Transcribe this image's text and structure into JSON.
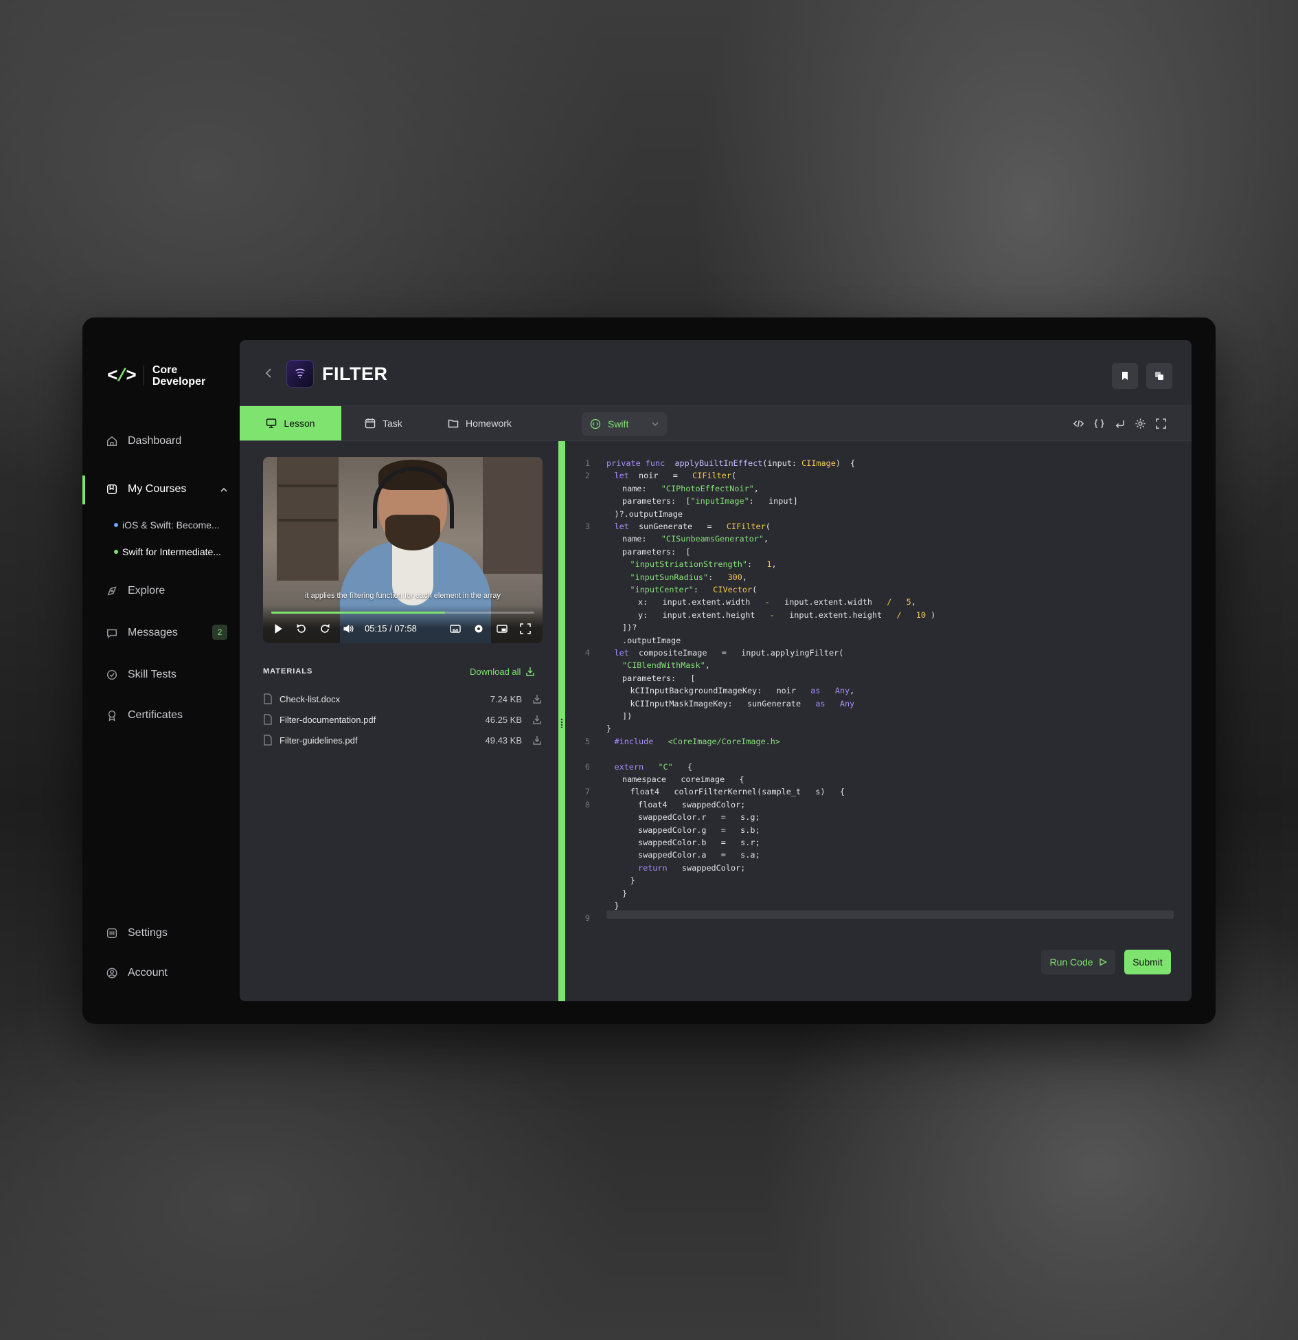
{
  "brand": {
    "line1": "Core",
    "line2": "Developer"
  },
  "nav": {
    "dashboard": "Dashboard",
    "my_courses": "My Courses",
    "courses": [
      {
        "label": "iOS & Swift: Become...",
        "dot_color": "#6aa8ff"
      },
      {
        "label": "Swift for Intermediate...",
        "dot_color": "#7ee36f"
      }
    ],
    "explore": "Explore",
    "messages": "Messages",
    "messages_count": "2",
    "skill_tests": "Skill Tests",
    "certificates": "Certificates",
    "settings": "Settings",
    "account": "Account"
  },
  "header": {
    "title": "FILTER"
  },
  "tabs": {
    "lesson": "Lesson",
    "task": "Task",
    "homework": "Homework",
    "language": "Swift"
  },
  "video": {
    "subtitle": "it applies the filtering function for each element in the array",
    "time": "05:15 / 07:58",
    "progress": 0.66
  },
  "materials": {
    "heading": "MATERIALS",
    "download_all": "Download all",
    "files": [
      {
        "name": "Check-list.docx",
        "size": "7.24 KB"
      },
      {
        "name": "Filter-documentation.pdf",
        "size": "46.25 KB"
      },
      {
        "name": "Filter-guidelines.pdf",
        "size": "49.43 KB"
      }
    ]
  },
  "code": {
    "lines": [
      {
        "n": "1",
        "indent": 0,
        "tokens": [
          [
            "kw",
            "private func  "
          ],
          [
            "fn",
            "applyBuiltInEffect"
          ],
          [
            "",
            "(input: "
          ],
          [
            "ty",
            "CIImage"
          ],
          [
            "",
            ")  {"
          ]
        ]
      },
      {
        "n": "2",
        "indent": 1,
        "tokens": [
          [
            "kw",
            "let  "
          ],
          [
            "",
            "noir   =   "
          ],
          [
            "ty",
            "CIFilter"
          ],
          [
            "",
            "("
          ]
        ]
      },
      {
        "n": "",
        "indent": 2,
        "tokens": [
          [
            "",
            "name:   "
          ],
          [
            "st",
            "\"CIPhotoEffectNoir\""
          ],
          [
            "",
            ","
          ]
        ]
      },
      {
        "n": "",
        "indent": 2,
        "tokens": [
          [
            "",
            "parameters:  ["
          ],
          [
            "st",
            "\"inputImage\""
          ],
          [
            "",
            ":   input]"
          ]
        ]
      },
      {
        "n": "",
        "indent": 1,
        "tokens": [
          [
            "",
            ")?.outputImage"
          ]
        ]
      },
      {
        "n": "3",
        "indent": 1,
        "tokens": [
          [
            "kw",
            "let  "
          ],
          [
            "",
            "sunGenerate   =   "
          ],
          [
            "ty",
            "CIFilter"
          ],
          [
            "",
            "("
          ]
        ]
      },
      {
        "n": "",
        "indent": 2,
        "tokens": [
          [
            "",
            "name:   "
          ],
          [
            "st",
            "\"CISunbeamsGenerator\""
          ],
          [
            "",
            ","
          ]
        ]
      },
      {
        "n": "",
        "indent": 2,
        "tokens": [
          [
            "",
            "parameters:  ["
          ]
        ]
      },
      {
        "n": "",
        "indent": 3,
        "tokens": [
          [
            "st",
            "\"inputStriationStrength\""
          ],
          [
            "",
            ":   "
          ],
          [
            "nu",
            "1"
          ],
          [
            "",
            ","
          ]
        ]
      },
      {
        "n": "",
        "indent": 3,
        "tokens": [
          [
            "st",
            "\"inputSunRadius\""
          ],
          [
            "",
            ":   "
          ],
          [
            "nu",
            "300"
          ],
          [
            "",
            ","
          ]
        ]
      },
      {
        "n": "",
        "indent": 3,
        "tokens": [
          [
            "st",
            "\"inputCenter\""
          ],
          [
            "",
            ":   "
          ],
          [
            "ty",
            "CIVector"
          ],
          [
            "",
            "("
          ]
        ]
      },
      {
        "n": "",
        "indent": 4,
        "tokens": [
          [
            "",
            "x:   input.extent.width   "
          ],
          [
            "op",
            "-"
          ],
          [
            "",
            "   input.extent.width   "
          ],
          [
            "op",
            "/"
          ],
          [
            "",
            "   "
          ],
          [
            "nu",
            "5"
          ],
          [
            "",
            ","
          ]
        ]
      },
      {
        "n": "",
        "indent": 4,
        "tokens": [
          [
            "",
            "y:   input.extent.height   "
          ],
          [
            "op",
            "-"
          ],
          [
            "",
            "   input.extent.height   "
          ],
          [
            "op",
            "/"
          ],
          [
            "",
            "   "
          ],
          [
            "nu",
            "10"
          ],
          [
            "",
            " )"
          ]
        ]
      },
      {
        "n": "",
        "indent": 2,
        "tokens": [
          [
            "",
            "])?"
          ]
        ]
      },
      {
        "n": "",
        "indent": 2,
        "tokens": [
          [
            "",
            ".outputImage"
          ]
        ]
      },
      {
        "n": "4",
        "indent": 1,
        "tokens": [
          [
            "kw",
            "let  "
          ],
          [
            "",
            "compositeImage   =   input.applyingFilter("
          ]
        ]
      },
      {
        "n": "",
        "indent": 2,
        "tokens": [
          [
            "st",
            "\"CIBlendWithMask\""
          ],
          [
            "",
            ","
          ]
        ]
      },
      {
        "n": "",
        "indent": 2,
        "tokens": [
          [
            "",
            "parameters:   ["
          ]
        ]
      },
      {
        "n": "",
        "indent": 3,
        "tokens": [
          [
            "",
            "kCIInputBackgroundImageKey:   noir   "
          ],
          [
            "kw",
            "as"
          ],
          [
            "",
            "   "
          ],
          [
            "kw",
            "Any"
          ],
          [
            "",
            ","
          ]
        ]
      },
      {
        "n": "",
        "indent": 3,
        "tokens": [
          [
            "",
            "kCIInputMaskImageKey:   sunGenerate   "
          ],
          [
            "kw",
            "as"
          ],
          [
            "",
            "   "
          ],
          [
            "kw",
            "Any"
          ]
        ]
      },
      {
        "n": "",
        "indent": 2,
        "tokens": [
          [
            "",
            "])"
          ]
        ]
      },
      {
        "n": "",
        "indent": 0,
        "tokens": [
          [
            "",
            "}"
          ]
        ]
      },
      {
        "n": "5",
        "indent": 1,
        "tokens": [
          [
            "kw",
            "#include"
          ],
          [
            "",
            "   "
          ],
          [
            "st",
            "<CoreImage/CoreImage.h>"
          ]
        ]
      },
      {
        "n": "",
        "indent": 0,
        "tokens": []
      },
      {
        "n": "6",
        "indent": 1,
        "tokens": [
          [
            "kw",
            "extern"
          ],
          [
            "",
            "   "
          ],
          [
            "st",
            "\"C\""
          ],
          [
            "",
            "   {"
          ]
        ]
      },
      {
        "n": "",
        "indent": 2,
        "tokens": [
          [
            "",
            "namespace   coreimage   {"
          ]
        ]
      },
      {
        "n": "7",
        "indent": 3,
        "tokens": [
          [
            "",
            "float4   colorFilterKernel(sample_t   s)   {"
          ]
        ]
      },
      {
        "n": "8",
        "indent": 4,
        "tokens": [
          [
            "",
            "float4   swappedColor;"
          ]
        ]
      },
      {
        "n": "",
        "indent": 4,
        "tokens": [
          [
            "",
            "swappedColor.r   =   s.g;"
          ]
        ]
      },
      {
        "n": "",
        "indent": 4,
        "tokens": [
          [
            "",
            "swappedColor.g   =   s.b;"
          ]
        ]
      },
      {
        "n": "",
        "indent": 4,
        "tokens": [
          [
            "",
            "swappedColor.b   =   s.r;"
          ]
        ]
      },
      {
        "n": "",
        "indent": 4,
        "tokens": [
          [
            "",
            "swappedColor.a   =   s.a;"
          ]
        ]
      },
      {
        "n": "",
        "indent": 4,
        "tokens": [
          [
            "kw",
            "return"
          ],
          [
            "",
            "   swappedColor;"
          ]
        ]
      },
      {
        "n": "",
        "indent": 3,
        "tokens": [
          [
            "",
            "}"
          ]
        ]
      },
      {
        "n": "",
        "indent": 2,
        "tokens": [
          [
            "",
            "}"
          ]
        ]
      },
      {
        "n": "",
        "indent": 1,
        "tokens": [
          [
            "",
            "}"
          ]
        ]
      },
      {
        "n": "9",
        "indent": 0,
        "tokens": []
      }
    ]
  },
  "actions": {
    "run_code": "Run Code",
    "submit": "Submit"
  },
  "colors": {
    "accent": "#7ee36f",
    "panel": "#2a2b30",
    "frame": "#0b0b0c"
  }
}
